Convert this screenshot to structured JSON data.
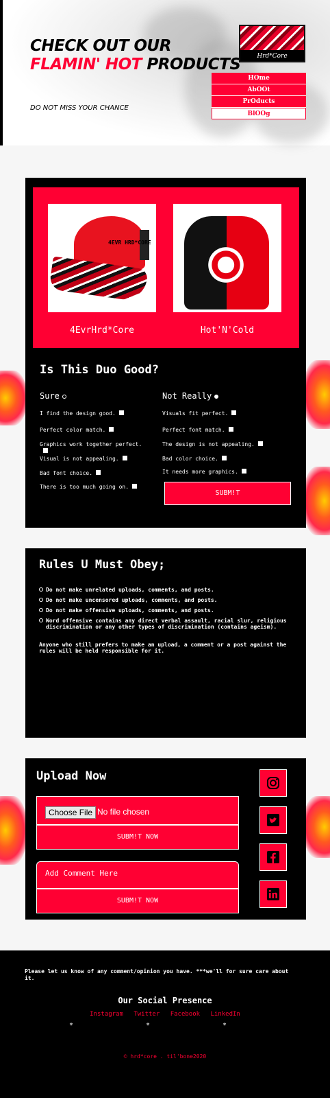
{
  "header": {
    "title_line1": "CHECK OUT OUR",
    "title_red": "FLAMIN' HOT",
    "title_rest": " PRODUCTS",
    "tagline": "DO NOT MISS YOUR CHANCE",
    "logo_text": "Hrd*Core"
  },
  "nav": {
    "items": [
      "HOme",
      "AbOOt",
      "PrOducts",
      "BlOOg"
    ]
  },
  "products": [
    {
      "name": "4EvrHrd*Core",
      "image_label": "4EVR HRD*CORE"
    },
    {
      "name": "Hot'N'Cold"
    }
  ],
  "survey": {
    "title": "Is This Duo Good?",
    "col_a": "Sure",
    "col_b": "Not Really",
    "options_a": [
      "I find the design good.",
      "Perfect color match.",
      "Graphics work together perfect.",
      "Visual is not appealing.",
      "Bad font choice.",
      "There is too much going on."
    ],
    "options_b": [
      "Visuals fit perfect.",
      "Perfect font match.",
      "The design is not appealing.",
      "Bad color choice.",
      "It needs more graphics."
    ],
    "submit": "SUBM!T"
  },
  "rules": {
    "title": "Rules U Must Obey;",
    "items": [
      "Do not make unrelated uploads, comments, and posts.",
      "Do not make uncensored uploads, comments, and posts.",
      "Do not make offensive uploads, comments, and posts.",
      "Word offensive contains any direct verbal assault, racial slur, religious discrimination or any other types of discrimination (contains ageism)."
    ],
    "note": "Anyone who still prefers to make an upload, a comment or a post against the rules will be held responsible for it."
  },
  "upload": {
    "title": "Upload Now",
    "choose_file": "Choose File",
    "no_file": "No file chosen",
    "submit_now": "SUBM!T NOW",
    "comment_placeholder": "Add Comment Here",
    "submit_now_2": "SUBM!T NOW"
  },
  "social_icons": [
    "instagram-icon",
    "twitter-icon",
    "facebook-icon",
    "linkedin-icon"
  ],
  "footer": {
    "message": "Please let us know of any comment/opinion you have. ***we'll for sure care about it.",
    "social_title": "Our Social Presence",
    "links": [
      "Instagram",
      "Twitter",
      "Facebook",
      "LinkedIn"
    ],
    "dots": "* * *",
    "copyright": "© hrd*core . til'bone2020"
  },
  "colors": {
    "accent": "#ff0033",
    "panel": "#000000",
    "background": "#f6f6f6"
  }
}
